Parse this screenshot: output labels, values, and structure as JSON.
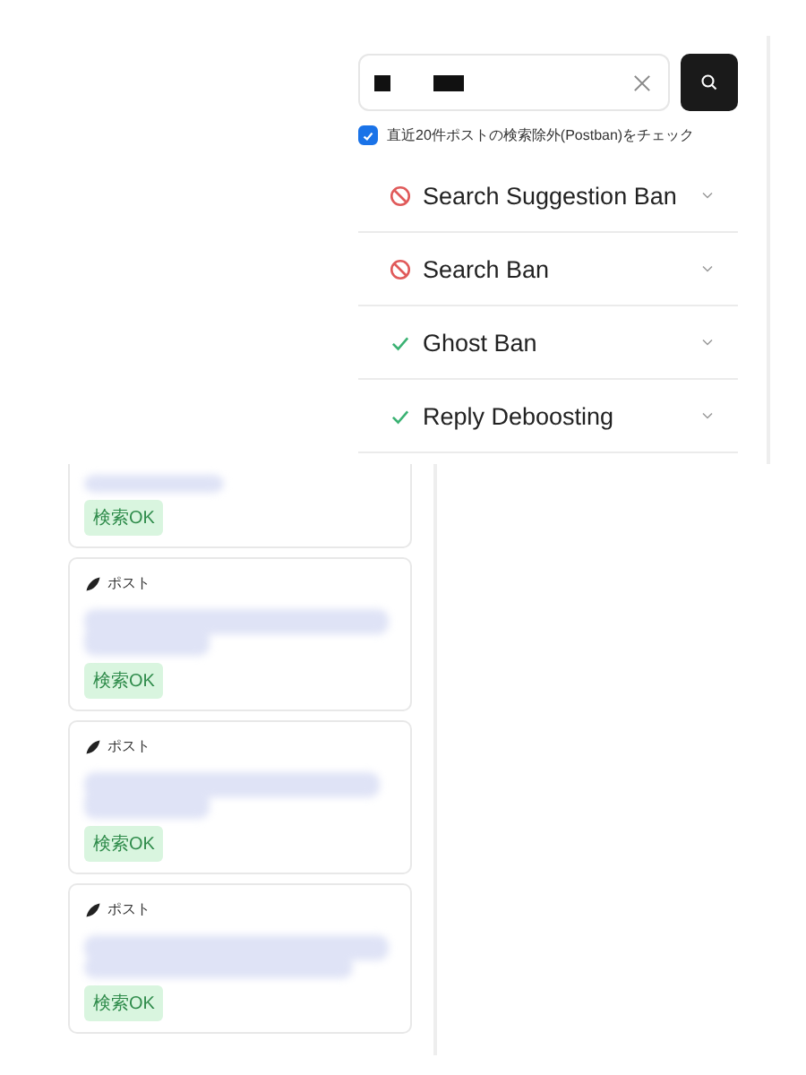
{
  "postban_check": {
    "label": "直近20件ポストの検索除外(Postban)をチェック",
    "checked": true
  },
  "checks": [
    {
      "label": "Search Suggestion Ban",
      "kind": "ban",
      "expanded": false
    },
    {
      "label": "Search Ban",
      "kind": "ban",
      "expanded": false
    },
    {
      "label": "Ghost Ban",
      "kind": "ok",
      "expanded": false
    },
    {
      "label": "Reply Deboosting",
      "kind": "ok",
      "expanded": false
    }
  ],
  "posts": [
    {
      "badge": "検索OK"
    },
    {
      "label": "ポスト",
      "badge": "検索OK"
    },
    {
      "label": "ポスト",
      "badge": "検索OK"
    },
    {
      "label": "ポスト",
      "badge": "検索OK"
    }
  ]
}
